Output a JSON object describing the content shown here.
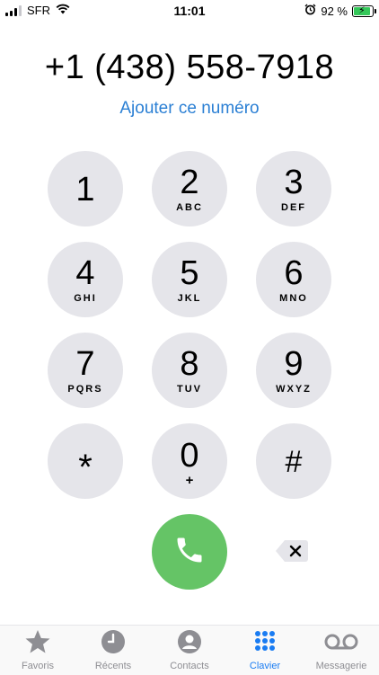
{
  "status_bar": {
    "carrier": "SFR",
    "time": "11:01",
    "battery": "92 %"
  },
  "dialer": {
    "number": "+1 (438) 558-7918",
    "add_number": "Ajouter ce numéro",
    "keys": [
      {
        "digit": "1",
        "letters": ""
      },
      {
        "digit": "2",
        "letters": "ABC"
      },
      {
        "digit": "3",
        "letters": "DEF"
      },
      {
        "digit": "4",
        "letters": "GHI"
      },
      {
        "digit": "5",
        "letters": "JKL"
      },
      {
        "digit": "6",
        "letters": "MNO"
      },
      {
        "digit": "7",
        "letters": "PQRS"
      },
      {
        "digit": "8",
        "letters": "TUV"
      },
      {
        "digit": "9",
        "letters": "WXYZ"
      },
      {
        "digit": "*",
        "letters": ""
      },
      {
        "digit": "0",
        "letters": "+"
      },
      {
        "digit": "#",
        "letters": ""
      }
    ]
  },
  "tab_bar": {
    "items": [
      {
        "label": "Favoris",
        "icon": "star-icon"
      },
      {
        "label": "Récents",
        "icon": "clock-icon"
      },
      {
        "label": "Contacts",
        "icon": "person-icon"
      },
      {
        "label": "Clavier",
        "icon": "keypad-icon",
        "active": true
      },
      {
        "label": "Messagerie",
        "icon": "voicemail-icon"
      }
    ]
  },
  "colors": {
    "accent": "#1a7cf2",
    "link": "#2a7fd4",
    "call_green": "#65c466",
    "key_bg": "#e5e5ea",
    "inactive": "#8e8e93"
  }
}
